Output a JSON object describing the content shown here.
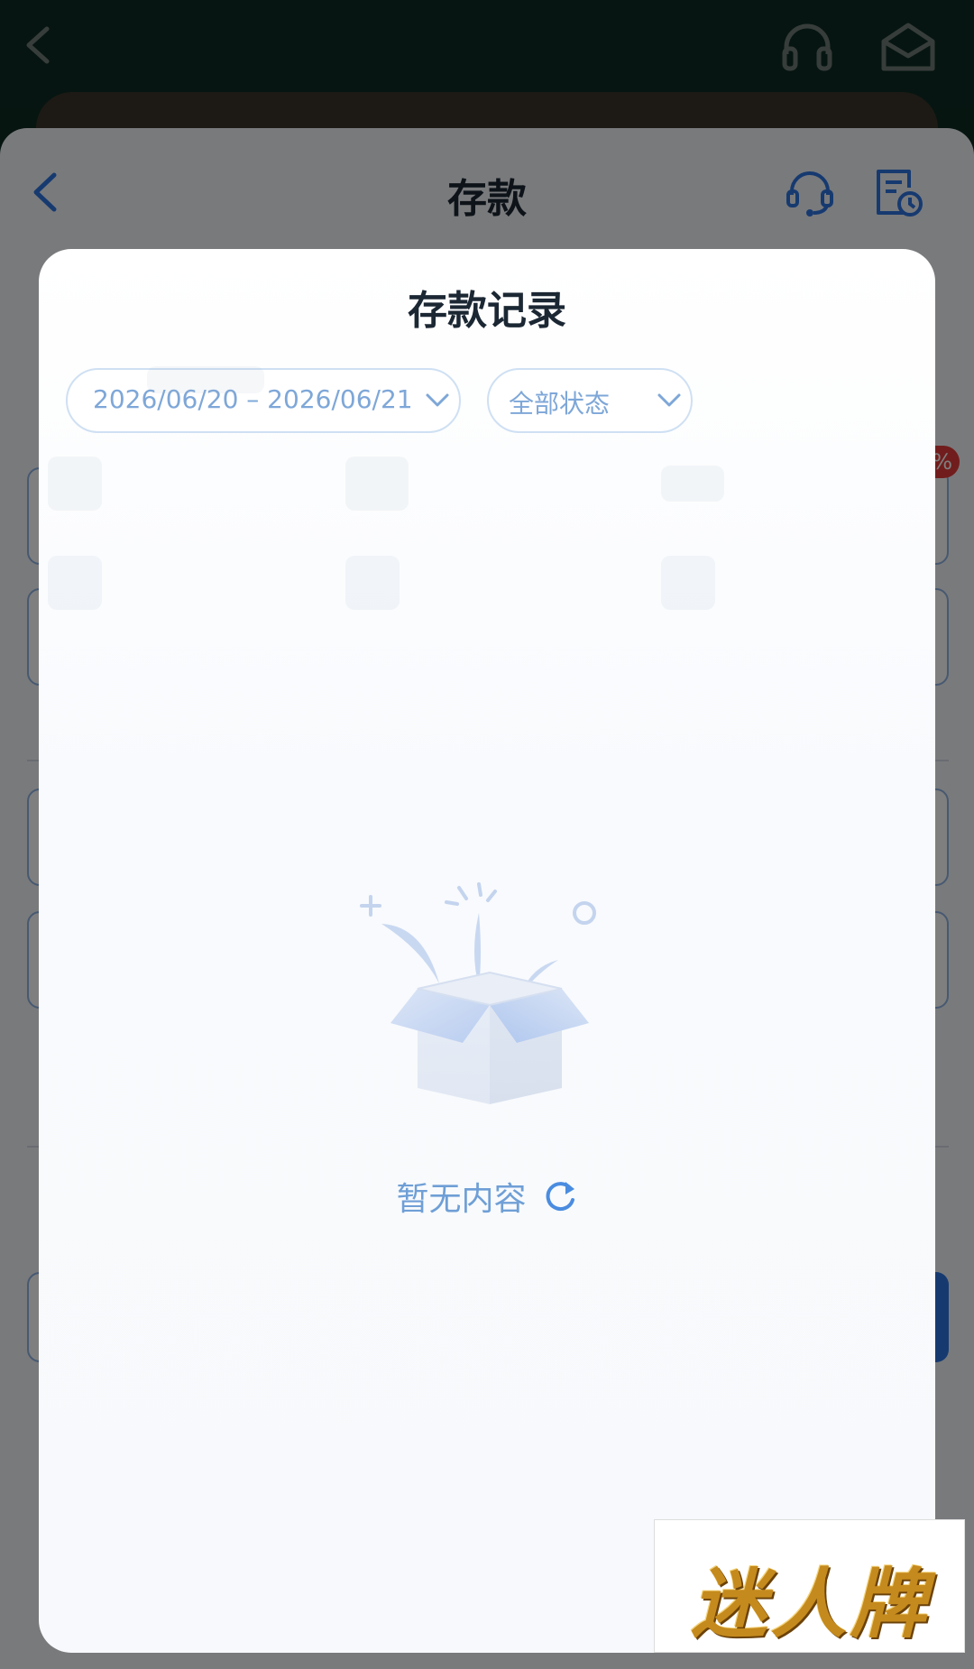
{
  "app_bar": {
    "back_icon": "chevron-left-icon",
    "support_icon": "headphones-icon",
    "mail_icon": "mail-icon"
  },
  "sheet": {
    "title": "存款",
    "back_icon": "chevron-left-icon",
    "support_icon": "customer-service-icon",
    "history_icon": "history-record-icon"
  },
  "modal": {
    "title": "存款记录",
    "date_filter": {
      "value": "2026/06/20 – 2026/06/21",
      "icon": "chevron-down-icon"
    },
    "status_filter": {
      "value": "全部状态",
      "icon": "chevron-down-icon"
    },
    "empty_state": {
      "text": "暂无内容",
      "illustration": "open-box-icon",
      "refresh_icon": "refresh-icon"
    }
  },
  "watermark": {
    "text": "迷人牌"
  },
  "colors": {
    "app_bar": "#0d2a22",
    "accent_blue": "#2c74e0",
    "filter_text": "#7ea7d8",
    "empty_text": "#6f9fd6",
    "badge_red": "#e23b3b"
  }
}
